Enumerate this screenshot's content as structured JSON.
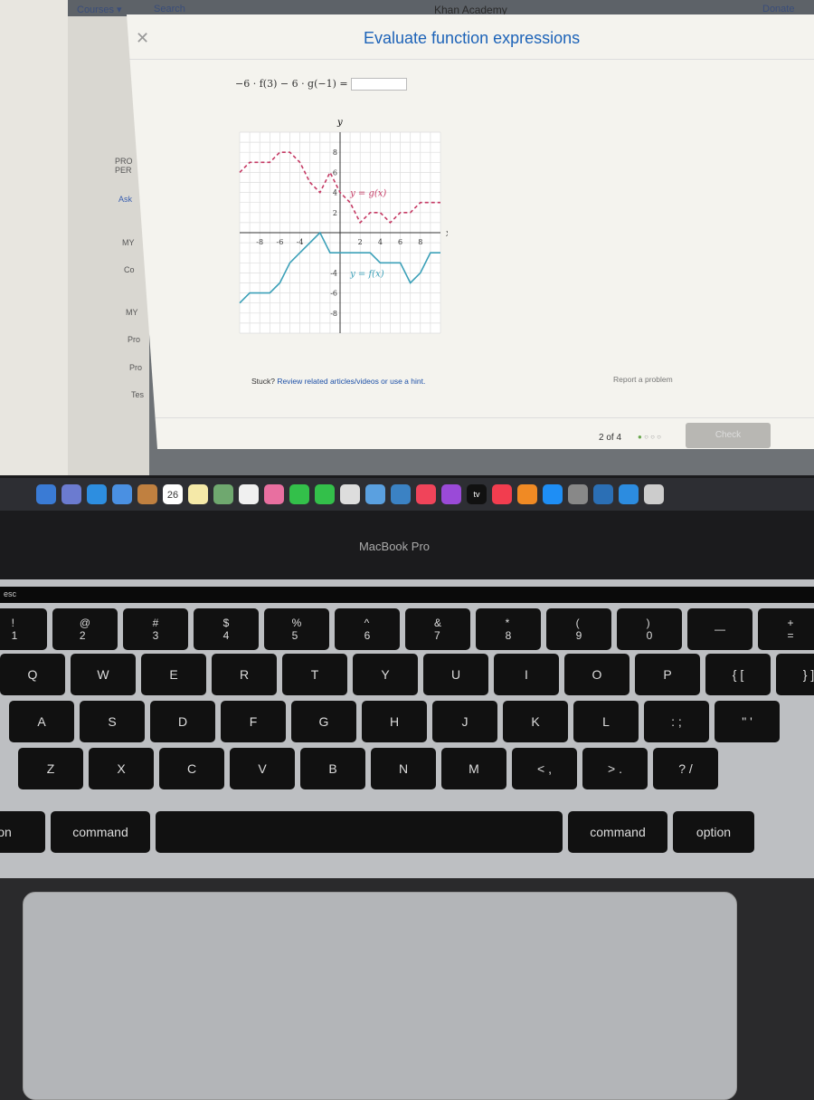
{
  "browser": {
    "nav_courses": "Courses ▾",
    "nav_search": "Search",
    "site_title": "Khan Academy",
    "nav_right": "Donate"
  },
  "sidebar": {
    "items": [
      "PRO",
      "PER",
      "Ask",
      "MY",
      "Co",
      "MY",
      "Pro",
      "Pro",
      "Tes"
    ]
  },
  "modal": {
    "title": "Evaluate function expressions",
    "question": "−6 · f(3) − 6 · g(−1) =",
    "answer_value": "",
    "stuck_prefix": "Stuck?",
    "stuck_link": "Review related articles/videos or use a hint.",
    "report": "Report a problem",
    "progress": "2 of 4",
    "check": "Check"
  },
  "chart_data": {
    "type": "line",
    "xlabel": "x",
    "ylabel": "y",
    "xlim": [
      -10,
      10
    ],
    "ylim": [
      -10,
      10
    ],
    "grid": true,
    "x_ticks": [
      -8,
      -6,
      -4,
      2,
      4,
      6,
      8
    ],
    "y_ticks": [
      8,
      6,
      4,
      2,
      -4,
      -6,
      -8
    ],
    "series": [
      {
        "name": "y = g(x)",
        "color": "#c53a64",
        "dashed": true,
        "points": [
          [
            -10,
            6
          ],
          [
            -9,
            7
          ],
          [
            -7,
            7
          ],
          [
            -6,
            8
          ],
          [
            -5,
            8
          ],
          [
            -4,
            7
          ],
          [
            -3,
            5
          ],
          [
            -2,
            4
          ],
          [
            -1,
            6
          ],
          [
            0,
            4
          ],
          [
            1,
            3
          ],
          [
            2,
            1
          ],
          [
            3,
            2
          ],
          [
            4,
            2
          ],
          [
            5,
            1
          ],
          [
            6,
            2
          ],
          [
            7,
            2
          ],
          [
            8,
            3
          ],
          [
            10,
            3
          ]
        ]
      },
      {
        "name": "y = f(x)",
        "color": "#3ba0b8",
        "dashed": false,
        "points": [
          [
            -10,
            -7
          ],
          [
            -9,
            -6
          ],
          [
            -7,
            -6
          ],
          [
            -6,
            -5
          ],
          [
            -5,
            -3
          ],
          [
            -4,
            -2
          ],
          [
            -2,
            0
          ],
          [
            -1,
            -2
          ],
          [
            3,
            -2
          ],
          [
            4,
            -3
          ],
          [
            6,
            -3
          ],
          [
            7,
            -5
          ],
          [
            8,
            -4
          ],
          [
            9,
            -2
          ],
          [
            10,
            -2
          ]
        ]
      }
    ]
  },
  "dock": {
    "calendar_day": "26",
    "tv_label": "tv"
  },
  "laptop": {
    "brand": "MacBook Pro"
  },
  "touchbar": {
    "esc": "esc"
  },
  "keyboard": {
    "row1": [
      "!\n1",
      "@\n2",
      "#\n3",
      "$\n4",
      "%\n5",
      "^\n6",
      "&\n7",
      "*\n8",
      "(\n9",
      ")\n0",
      "—",
      "+\n="
    ],
    "row2": [
      "Q",
      "W",
      "E",
      "R",
      "T",
      "Y",
      "U",
      "I",
      "O",
      "P",
      "{ [",
      "} ]"
    ],
    "row3": [
      "A",
      "S",
      "D",
      "F",
      "G",
      "H",
      "J",
      "K",
      "L",
      ": ;",
      "\" '"
    ],
    "row4": [
      "Z",
      "X",
      "C",
      "V",
      "B",
      "N",
      "M",
      "< ,",
      "> .",
      "? /"
    ],
    "row5": [
      "on",
      "command",
      "",
      "command",
      "option"
    ]
  }
}
